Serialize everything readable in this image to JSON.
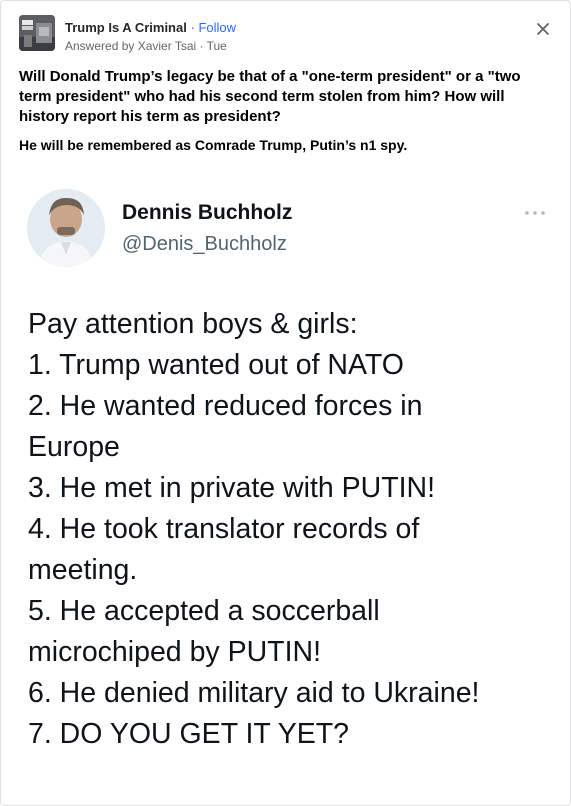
{
  "header": {
    "space_name": "Trump Is A Criminal",
    "separator": "·",
    "follow_label": "Follow",
    "answered_by": "Answered by Xavier Tsai · Tue"
  },
  "question": "Will Donald Trump’s legacy be that of a \"one-term president\" or a \"two term president\" who had his second term stolen from him? How will history report his term as president?",
  "answer": "He will be remembered as Comrade Trump, Putin’s n1 spy.",
  "tweet": {
    "name": "Dennis Buchholz",
    "handle": "@Denis_Buchholz",
    "lines": [
      "Pay attention boys & girls:",
      "1. Trump wanted out of NATO",
      "2. He wanted reduced forces in",
      "Europe",
      "3. He met in private with PUTIN!",
      "4. He took translator records of",
      "meeting.",
      "5. He accepted a soccerball",
      "microchiped by PUTIN!",
      "6. He denied military aid to Ukraine!",
      "7. DO YOU GET IT YET?"
    ]
  },
  "icons": {
    "close": "close-icon",
    "more": "more-horizontal-icon",
    "space_avatar": "space-logo-icon",
    "tweet_avatar": "profile-photo"
  },
  "colors": {
    "follow": "#2e69ff",
    "meta": "#636466",
    "tweet_text": "#0f1419",
    "handle": "#536471"
  }
}
